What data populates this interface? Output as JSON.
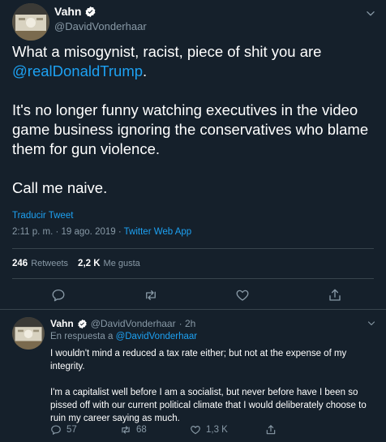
{
  "tweet": {
    "author_name": "Vahn",
    "author_handle": "@DavidVonderhaar",
    "text_line1": "What a misogynist, racist, piece of shit you are ",
    "mention": "@realDonaldTrump",
    "mention_suffix": ".",
    "paragraph2": "It's no longer funny watching executives in the video game business ignoring the conservatives who blame them for gun violence.",
    "paragraph3": "Call me naive.",
    "translate_label": "Traducir Tweet",
    "timestamp": "2:11 p. m. · 19 ago. 2019 · ",
    "source_app": "Twitter Web App",
    "retweets_count": "246",
    "retweets_label": "Retweets",
    "likes_count": "2,2 K",
    "likes_label": "Me gusta"
  },
  "reply": {
    "author_name": "Vahn",
    "author_handle": "@DavidVonderhaar",
    "time": " · 2h",
    "in_reply_prefix": "En respuesta a ",
    "in_reply_handle": "@DavidVonderhaar",
    "paragraph1": "I wouldn't mind a reduced a tax rate either; but not at the expense of my integrity.",
    "paragraph2": "I'm a capitalist well before I am a socialist, but never before have I been so pissed off with our current political climate that I would deliberately choose to ruin my career saying as much.",
    "reply_count": "57",
    "retweet_count": "68",
    "like_count": "1,3 K"
  },
  "colors": {
    "background": "#15202b",
    "accent": "#1da1f2",
    "secondary_text": "#8899a6",
    "divider": "#38444d"
  },
  "icons": [
    "verified-badge-icon",
    "chevron-down-icon",
    "reply-icon",
    "retweet-icon",
    "like-icon",
    "share-icon"
  ]
}
